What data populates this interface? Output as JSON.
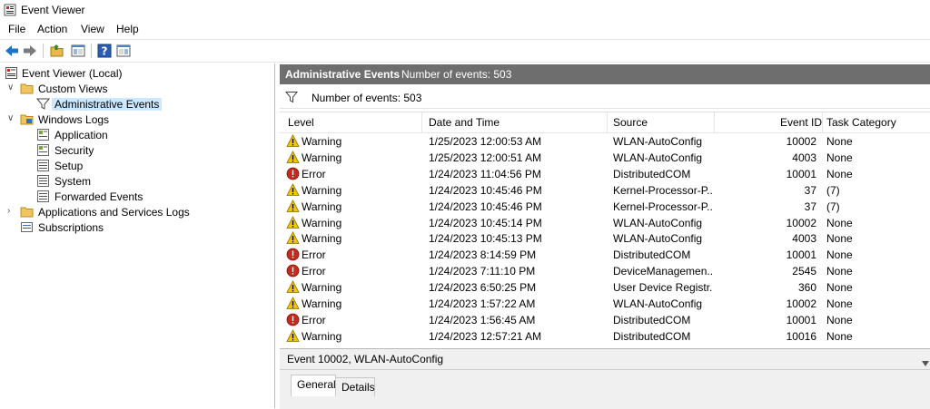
{
  "window": {
    "title": "Event Viewer"
  },
  "menu": [
    "File",
    "Action",
    "View",
    "Help"
  ],
  "toolbar": {
    "buttons": [
      "back-icon",
      "forward-icon",
      "open-folder-icon",
      "show-hide-pane-icon",
      "help-icon",
      "properties-pane-icon"
    ]
  },
  "tree": {
    "root": "Event Viewer (Local)",
    "custom_views": "Custom Views",
    "administrative_events": "Administrative Events",
    "windows_logs": "Windows Logs",
    "logs": [
      "Application",
      "Security",
      "Setup",
      "System",
      "Forwarded Events"
    ],
    "apps_services": "Applications and Services Logs",
    "subscriptions": "Subscriptions"
  },
  "header": {
    "title": "Administrative Events",
    "count": "Number of events: 503"
  },
  "filter": {
    "text": "Number of events: 503"
  },
  "grid": {
    "columns": [
      "Level",
      "Date and Time",
      "Source",
      "Event ID",
      "Task Category"
    ],
    "rows": [
      {
        "level": "Warning",
        "date": "1/25/2023 12:00:53 AM",
        "source": "WLAN-AutoConfig",
        "id": "10002",
        "cat": "None"
      },
      {
        "level": "Warning",
        "date": "1/25/2023 12:00:51 AM",
        "source": "WLAN-AutoConfig",
        "id": "4003",
        "cat": "None"
      },
      {
        "level": "Error",
        "date": "1/24/2023 11:04:56 PM",
        "source": "DistributedCOM",
        "id": "10001",
        "cat": "None"
      },
      {
        "level": "Warning",
        "date": "1/24/2023 10:45:46 PM",
        "source": "Kernel-Processor-P...",
        "id": "37",
        "cat": "(7)"
      },
      {
        "level": "Warning",
        "date": "1/24/2023 10:45:46 PM",
        "source": "Kernel-Processor-P...",
        "id": "37",
        "cat": "(7)"
      },
      {
        "level": "Warning",
        "date": "1/24/2023 10:45:14 PM",
        "source": "WLAN-AutoConfig",
        "id": "10002",
        "cat": "None"
      },
      {
        "level": "Warning",
        "date": "1/24/2023 10:45:13 PM",
        "source": "WLAN-AutoConfig",
        "id": "4003",
        "cat": "None"
      },
      {
        "level": "Error",
        "date": "1/24/2023 8:14:59 PM",
        "source": "DistributedCOM",
        "id": "10001",
        "cat": "None"
      },
      {
        "level": "Error",
        "date": "1/24/2023 7:11:10 PM",
        "source": "DeviceManagemen...",
        "id": "2545",
        "cat": "None"
      },
      {
        "level": "Warning",
        "date": "1/24/2023 6:50:25 PM",
        "source": "User Device Registr...",
        "id": "360",
        "cat": "None"
      },
      {
        "level": "Warning",
        "date": "1/24/2023 1:57:22 AM",
        "source": "WLAN-AutoConfig",
        "id": "10002",
        "cat": "None"
      },
      {
        "level": "Error",
        "date": "1/24/2023 1:56:45 AM",
        "source": "DistributedCOM",
        "id": "10001",
        "cat": "None"
      },
      {
        "level": "Warning",
        "date": "1/24/2023 12:57:21 AM",
        "source": "DistributedCOM",
        "id": "10016",
        "cat": "None"
      }
    ]
  },
  "detail": {
    "title": "Event 10002, WLAN-AutoConfig",
    "tabs": [
      "General",
      "Details"
    ],
    "active_tab": "General"
  },
  "colors": {
    "header_bg": "#6e6e6e",
    "selection": "#cce8ff",
    "warning": "#f2c600",
    "error": "#c42b1c"
  }
}
